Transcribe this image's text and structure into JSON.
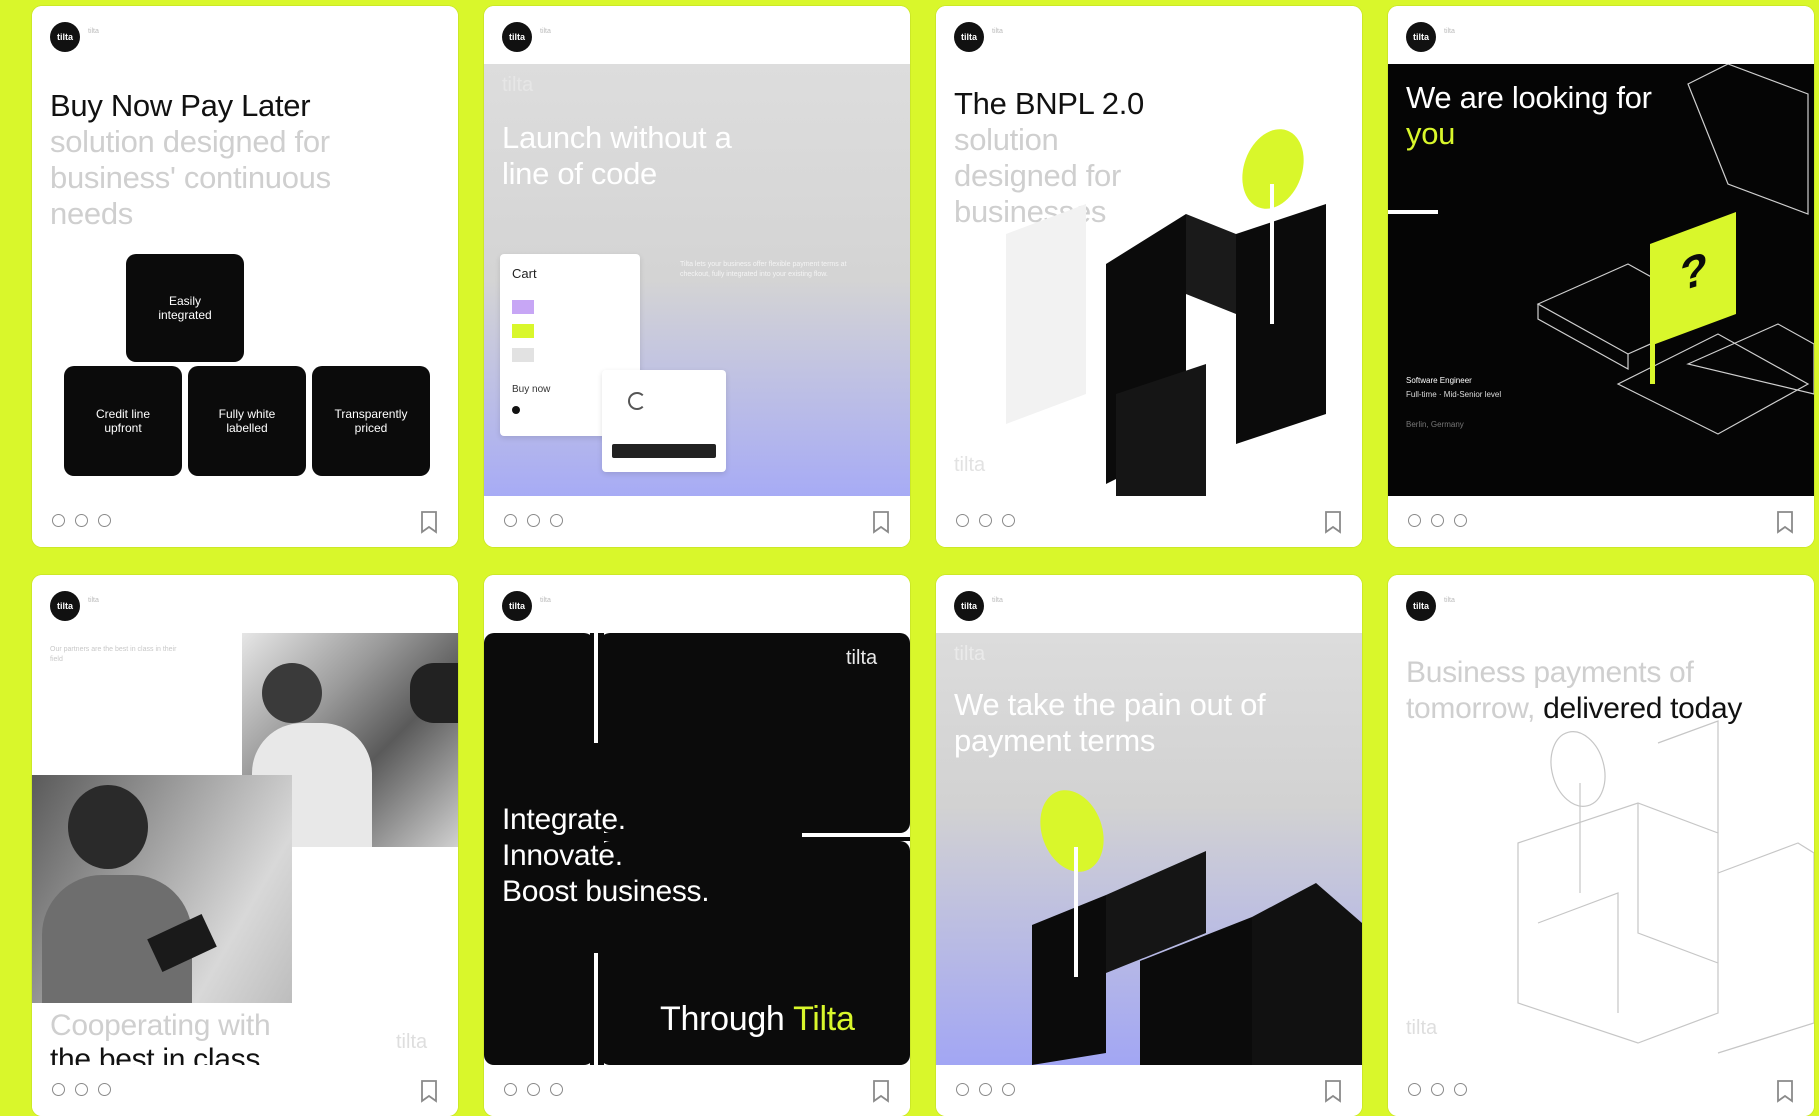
{
  "colors": {
    "background": "#d9f72b",
    "accent": "#d9f72b",
    "dark": "#0b0b0b",
    "light_text": "#cfcfcf"
  },
  "account": {
    "avatar_label": "tilta",
    "handle": "tilta"
  },
  "icons": {
    "carousel": "carousel-dot-icon",
    "save": "bookmark-icon",
    "avatar": "avatar-icon"
  },
  "posts": [
    {
      "title": "Buy Now Pay Later",
      "subtitle": "solution designed for business' continuous needs",
      "blocks": [
        "Easily integrated",
        "Credit line upfront",
        "Fully white labelled",
        "Transparently priced"
      ]
    },
    {
      "brand": "tilta",
      "title": "Launch without a line of code",
      "cart_title": "Cart",
      "pay_label": "Buy now",
      "paragraph": "Tilta lets your business offer flexible payment terms at checkout, fully integrated into your existing flow."
    },
    {
      "title": "The BNPL 2.0",
      "subtitle": "solution designed for businesses",
      "brand": "tilta"
    },
    {
      "title": "We are looking for",
      "highlight": "you",
      "question": "?",
      "job_title": "Software Engineer",
      "job_meta": "Full-time · Mid-Senior level",
      "job_location": "Berlin, Germany"
    },
    {
      "kicker": "Our partners are the best in class in their field",
      "title_light": "Cooperating with",
      "title_dark": "the best in class",
      "brand": "tilta"
    },
    {
      "brand": "tilta",
      "headline": [
        "Integrate.",
        "Innovate.",
        "Boost business."
      ],
      "through": "Through",
      "through_brand": "Tilta"
    },
    {
      "brand": "tilta",
      "title": "We take the pain out of payment terms"
    },
    {
      "title_light": "Business payments of tomorrow,",
      "title_dark": "delivered today",
      "brand": "tilta"
    }
  ]
}
